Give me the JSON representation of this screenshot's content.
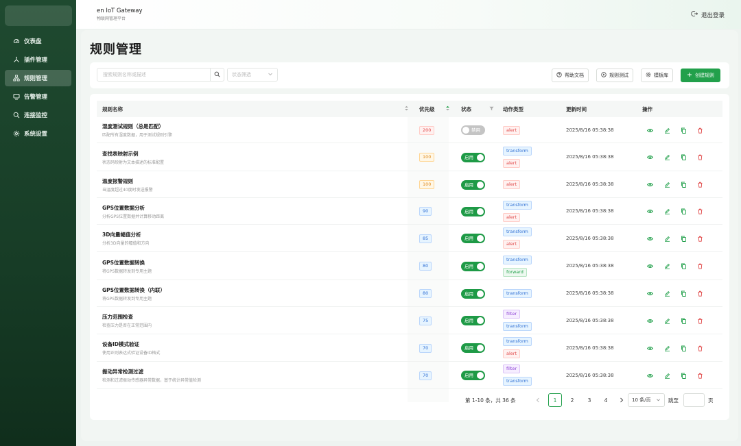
{
  "header": {
    "brand_title": "en IoT Gateway",
    "brand_sub": "物联网管理平台",
    "logout": "退出登录"
  },
  "sidebar": {
    "items": [
      {
        "label": "仪表盘",
        "icon": "dashboard-icon"
      },
      {
        "label": "插件管理",
        "icon": "plugin-icon"
      },
      {
        "label": "规则管理",
        "icon": "rules-icon",
        "active": true
      },
      {
        "label": "告警管理",
        "icon": "alarm-icon"
      },
      {
        "label": "连接监控",
        "icon": "monitor-icon"
      },
      {
        "label": "系统设置",
        "icon": "gear-icon"
      }
    ]
  },
  "page": {
    "title": "规则管理"
  },
  "toolbar": {
    "search_placeholder": "搜索规则名称或描述",
    "status_placeholder": "状态筛选",
    "help_label": "帮助文档",
    "test_label": "规则测试",
    "template_label": "模板库",
    "create_label": "创建规则"
  },
  "table": {
    "headers": {
      "name": "规则名称",
      "priority": "优先级",
      "status": "状态",
      "action_type": "动作类型",
      "updated": "更新时间",
      "ops": "操作"
    },
    "status_on": "启用",
    "status_off": "禁用",
    "rows": [
      {
        "name": "湿度测试规则（总是匹配）",
        "desc": "匹配所有湿度数据，用于测试规则引擎",
        "priority": "200",
        "pcolor": "red",
        "enabled": false,
        "tags": [
          "alert"
        ],
        "time": "2025/8/16 05:38:38"
      },
      {
        "name": "查找表映射示例",
        "desc": "状态码映射为文本描述的标准配置",
        "priority": "100",
        "pcolor": "orange",
        "enabled": true,
        "tags": [
          "transform",
          "alert"
        ],
        "time": "2025/8/16 05:38:38"
      },
      {
        "name": "温度报警规则",
        "desc": "当温度超过40度时发送报警",
        "priority": "100",
        "pcolor": "orange",
        "enabled": true,
        "tags": [
          "alert"
        ],
        "time": "2025/8/16 05:38:38"
      },
      {
        "name": "GPS位置数据分析",
        "desc": "分析GPS位置数据并计算移动距离",
        "priority": "90",
        "pcolor": "blue",
        "enabled": true,
        "tags": [
          "transform",
          "alert"
        ],
        "time": "2025/8/16 05:38:38"
      },
      {
        "name": "3D向量幅值分析",
        "desc": "分析3D向量的幅值和方向",
        "priority": "85",
        "pcolor": "blue",
        "enabled": true,
        "tags": [
          "transform",
          "alert"
        ],
        "time": "2025/8/16 05:38:38"
      },
      {
        "name": "GPS位置数据转换",
        "desc": "将GPS数据转发到专用主题",
        "priority": "80",
        "pcolor": "blue",
        "enabled": true,
        "tags": [
          "transform",
          "forward"
        ],
        "time": "2025/8/16 05:38:38"
      },
      {
        "name": "GPS位置数据转换（内联）",
        "desc": "将GPS数据转发到专用主题",
        "priority": "80",
        "pcolor": "blue",
        "enabled": true,
        "tags": [
          "transform"
        ],
        "time": "2025/8/16 05:38:38"
      },
      {
        "name": "压力范围检查",
        "desc": "检查压力是否在正常范围内",
        "priority": "75",
        "pcolor": "blue",
        "enabled": true,
        "tags": [
          "filter",
          "transform"
        ],
        "time": "2025/8/16 05:38:38"
      },
      {
        "name": "设备ID模式验证",
        "desc": "使用正则表达式验证设备ID格式",
        "priority": "70",
        "pcolor": "blue",
        "enabled": true,
        "tags": [
          "transform",
          "alert"
        ],
        "time": "2025/8/16 05:38:38"
      },
      {
        "name": "振动异常检测过滤",
        "desc": "检测和过滤振动传感器异常数据，基于统计异常值检测",
        "priority": "70",
        "pcolor": "blue",
        "enabled": true,
        "tags": [
          "filter",
          "transform"
        ],
        "time": "2025/8/16 05:38:38"
      }
    ]
  },
  "pagination": {
    "total_text": "第 1-10 条，共 36 条",
    "pages": [
      "1",
      "2",
      "3",
      "4"
    ],
    "current": "1",
    "page_size": "10 条/页",
    "jump_label": "跳至",
    "page_unit": "页"
  },
  "colors": {
    "sidebar": "#1f4a30",
    "primary": "#22a04b",
    "alert": "#e04848",
    "transform": "#2f6fd4",
    "filter": "#8a3fd4"
  }
}
